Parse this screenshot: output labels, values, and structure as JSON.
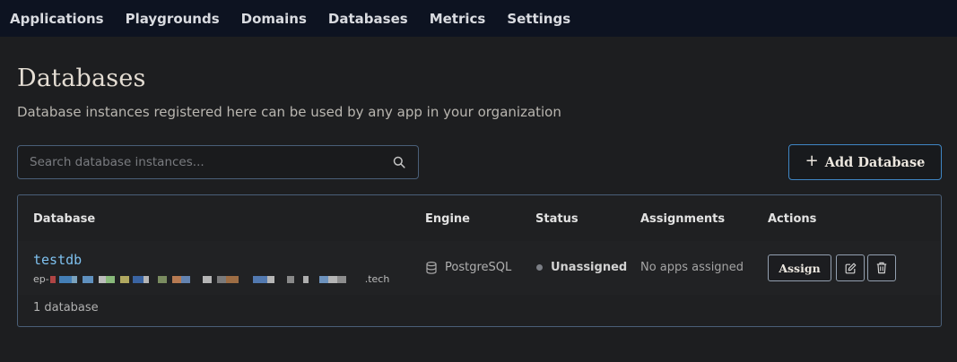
{
  "nav": {
    "items": [
      {
        "label": "Applications"
      },
      {
        "label": "Playgrounds"
      },
      {
        "label": "Domains"
      },
      {
        "label": "Databases"
      },
      {
        "label": "Metrics"
      },
      {
        "label": "Settings"
      }
    ]
  },
  "page": {
    "title": "Databases",
    "subtitle": "Database instances registered here can be used by any app in your organization"
  },
  "search": {
    "placeholder": "Search database instances...",
    "value": "",
    "icon": "search-icon"
  },
  "toolbar": {
    "add_label": "Add Database",
    "add_icon": "plus-icon"
  },
  "table": {
    "headers": {
      "database": "Database",
      "engine": "Engine",
      "status": "Status",
      "assignments": "Assignments",
      "actions": "Actions"
    },
    "rows": [
      {
        "name": "testdb",
        "host_prefix": "ep-",
        "host_suffix": ".tech",
        "engine": "PostgreSQL",
        "engine_icon": "database-icon",
        "status": "Unassigned",
        "status_color": "#7b7e85",
        "assignments": "No apps assigned",
        "assign_label": "Assign",
        "edit_icon": "edit-icon",
        "delete_icon": "trash-icon"
      }
    ],
    "count_label": "1 database"
  },
  "colors": {
    "nav_bg": "#0d1321",
    "page_bg": "#1d1e20",
    "accent": "#3f86c4",
    "link": "#7ec0ee",
    "border": "#4a5f78"
  }
}
